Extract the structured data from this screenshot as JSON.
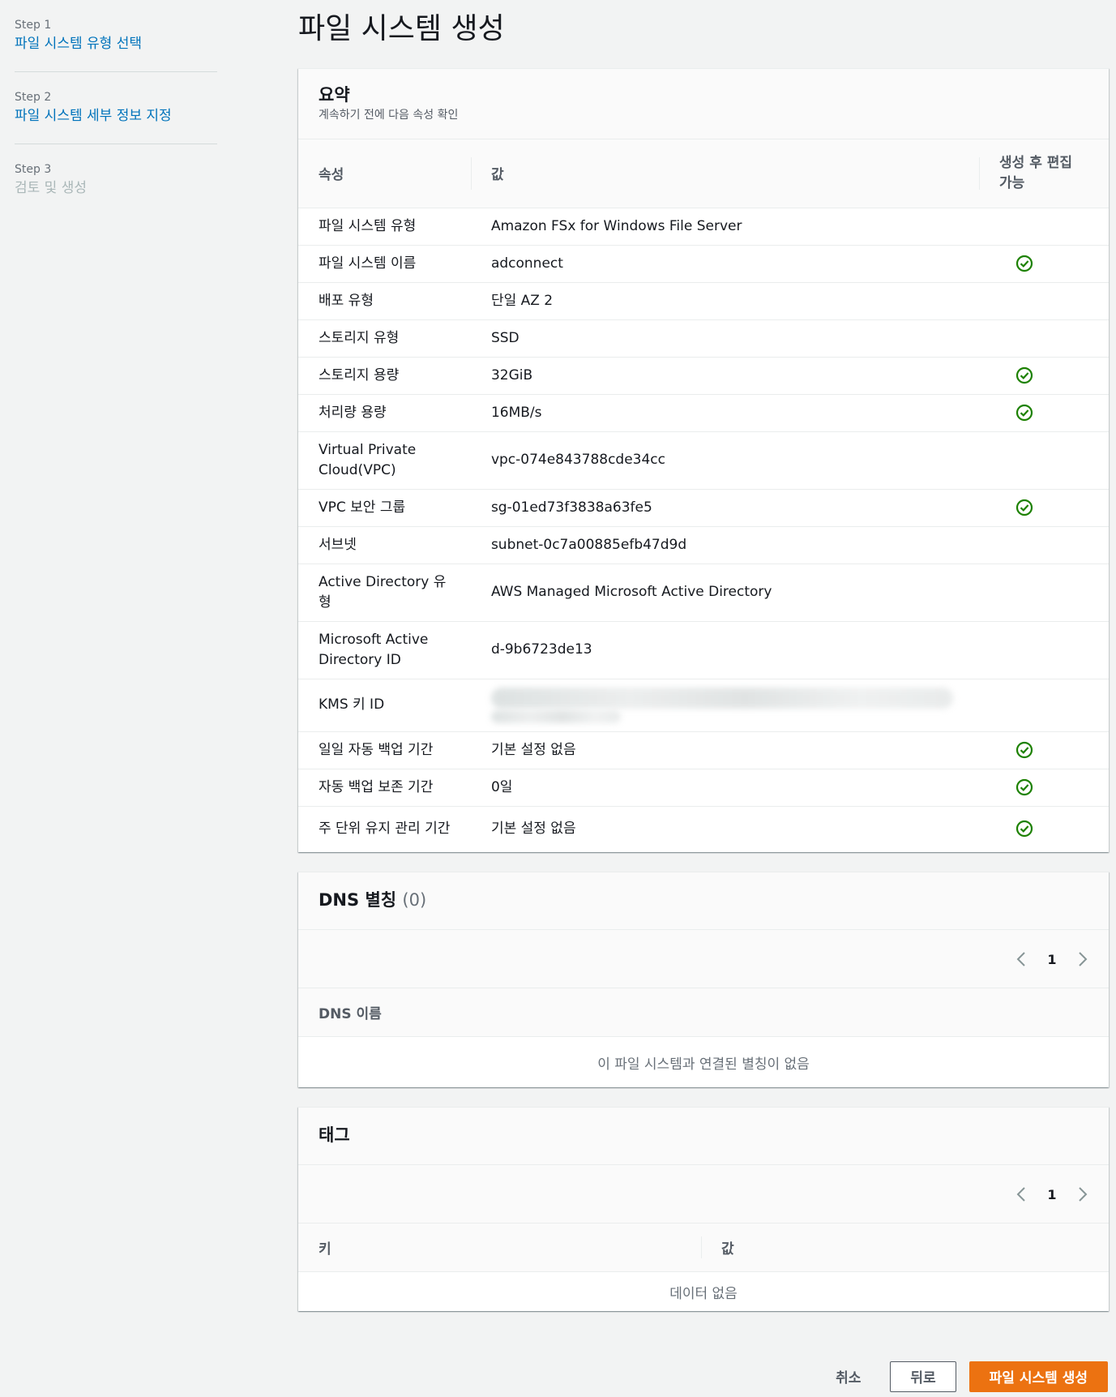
{
  "steps": [
    {
      "num": "Step 1",
      "title": "파일 시스템 유형 선택"
    },
    {
      "num": "Step 2",
      "title": "파일 시스템 세부 정보 지정"
    },
    {
      "num": "Step 3",
      "title": "검토 및 생성"
    }
  ],
  "page_title": "파일 시스템 생성",
  "summary": {
    "title": "요약",
    "description": "계속하기 전에 다음 속성 확인",
    "columns": {
      "attribute": "속성",
      "value": "값",
      "editable": "생성 후 편집 가능"
    },
    "rows": [
      {
        "attribute": "파일 시스템 유형",
        "value": "Amazon FSx for Windows File Server",
        "editable": false
      },
      {
        "attribute": "파일 시스템 이름",
        "value": "adconnect",
        "editable": true
      },
      {
        "attribute": "배포 유형",
        "value": "단일 AZ 2",
        "editable": false
      },
      {
        "attribute": "스토리지 유형",
        "value": "SSD",
        "editable": false
      },
      {
        "attribute": "스토리지 용량",
        "value": "32GiB",
        "editable": true
      },
      {
        "attribute": "처리량 용량",
        "value": "16MB/s",
        "editable": true
      },
      {
        "attribute": "Virtual Private Cloud(VPC)",
        "value": "vpc-074e843788cde34cc",
        "editable": false
      },
      {
        "attribute": "VPC 보안 그룹",
        "value": "sg-01ed73f3838a63fe5",
        "editable": true
      },
      {
        "attribute": "서브넷",
        "value": "subnet-0c7a00885efb47d9d",
        "editable": false
      },
      {
        "attribute": "Active Directory 유형",
        "value": "AWS Managed Microsoft Active Directory",
        "editable": false
      },
      {
        "attribute": "Microsoft Active Directory ID",
        "value": "d-9b6723de13",
        "editable": false
      },
      {
        "attribute": "KMS 키 ID",
        "value": "",
        "editable": false
      },
      {
        "attribute": "일일 자동 백업 기간",
        "value": "기본 설정 없음",
        "editable": true
      },
      {
        "attribute": "자동 백업 보존 기간",
        "value": "0일",
        "editable": true
      },
      {
        "attribute": "주 단위 유지 관리 기간",
        "value": "기본 설정 없음",
        "editable": true
      }
    ]
  },
  "dns": {
    "title": "DNS 별칭",
    "count": "(0)",
    "page": "1",
    "column": "DNS 이름",
    "empty": "이 파일 시스템과 연결된 별칭이 없음"
  },
  "tags": {
    "title": "태그",
    "page": "1",
    "col_key": "키",
    "col_value": "값",
    "empty": "데이터 없음"
  },
  "actions": {
    "cancel": "취소",
    "back": "뒤로",
    "create": "파일 시스템 생성"
  },
  "colors": {
    "link": "#0073bb",
    "primary": "#ec7211",
    "success": "#1d8102"
  }
}
